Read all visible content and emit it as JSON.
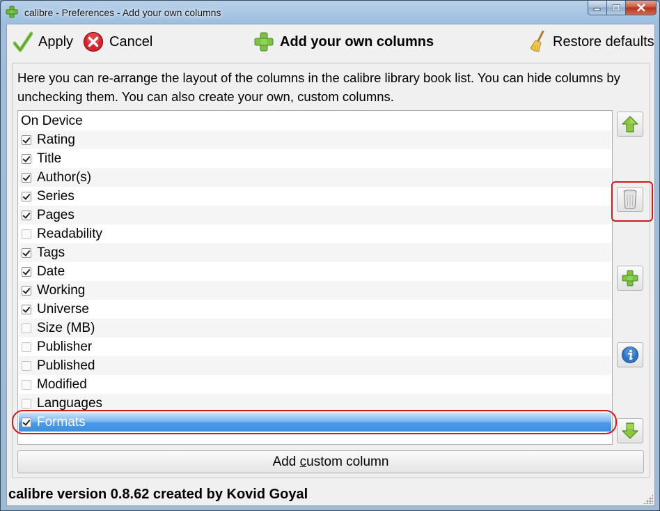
{
  "window": {
    "title": "calibre - Preferences - Add your own columns"
  },
  "toolbar": {
    "apply_label": "Apply",
    "cancel_label": "Cancel",
    "section_title": "Add your own columns",
    "restore_label": "Restore defaults"
  },
  "description": "Here you can re-arrange the layout of the columns in the calibre library book list. You can hide columns by unchecking them. You can also create your own, custom columns.",
  "columns": [
    {
      "label": "On Device",
      "checkbox": false,
      "checked": false
    },
    {
      "label": "Rating",
      "checkbox": true,
      "checked": true
    },
    {
      "label": "Title",
      "checkbox": true,
      "checked": true
    },
    {
      "label": "Author(s)",
      "checkbox": true,
      "checked": true
    },
    {
      "label": "Series",
      "checkbox": true,
      "checked": true
    },
    {
      "label": "Pages",
      "checkbox": true,
      "checked": true
    },
    {
      "label": "Readability",
      "checkbox": true,
      "checked": false
    },
    {
      "label": "Tags",
      "checkbox": true,
      "checked": true
    },
    {
      "label": "Date",
      "checkbox": true,
      "checked": true
    },
    {
      "label": "Working",
      "checkbox": true,
      "checked": true
    },
    {
      "label": "Universe",
      "checkbox": true,
      "checked": true
    },
    {
      "label": "Size (MB)",
      "checkbox": true,
      "checked": false
    },
    {
      "label": "Publisher",
      "checkbox": true,
      "checked": false
    },
    {
      "label": "Published",
      "checkbox": true,
      "checked": false
    },
    {
      "label": "Modified",
      "checkbox": true,
      "checked": false
    },
    {
      "label": "Languages",
      "checkbox": true,
      "checked": false
    },
    {
      "label": "Formats",
      "checkbox": true,
      "checked": true,
      "selected": true
    }
  ],
  "side_buttons": {
    "move_up_icon": "arrow-up-icon",
    "delete_icon": "trash-icon",
    "add_icon": "plus-icon",
    "info_icon": "info-icon",
    "move_down_icon": "arrow-down-icon"
  },
  "add_custom_column": {
    "label_before": "Add ",
    "label_mnemonic": "c",
    "label_after": "ustom column"
  },
  "footer": {
    "version_text": "calibre version 0.8.62 created by Kovid Goyal"
  },
  "colors": {
    "selection": "#3f8ee0",
    "highlight_annotation": "#d11a1a",
    "accent_green": "#5fae2e"
  }
}
